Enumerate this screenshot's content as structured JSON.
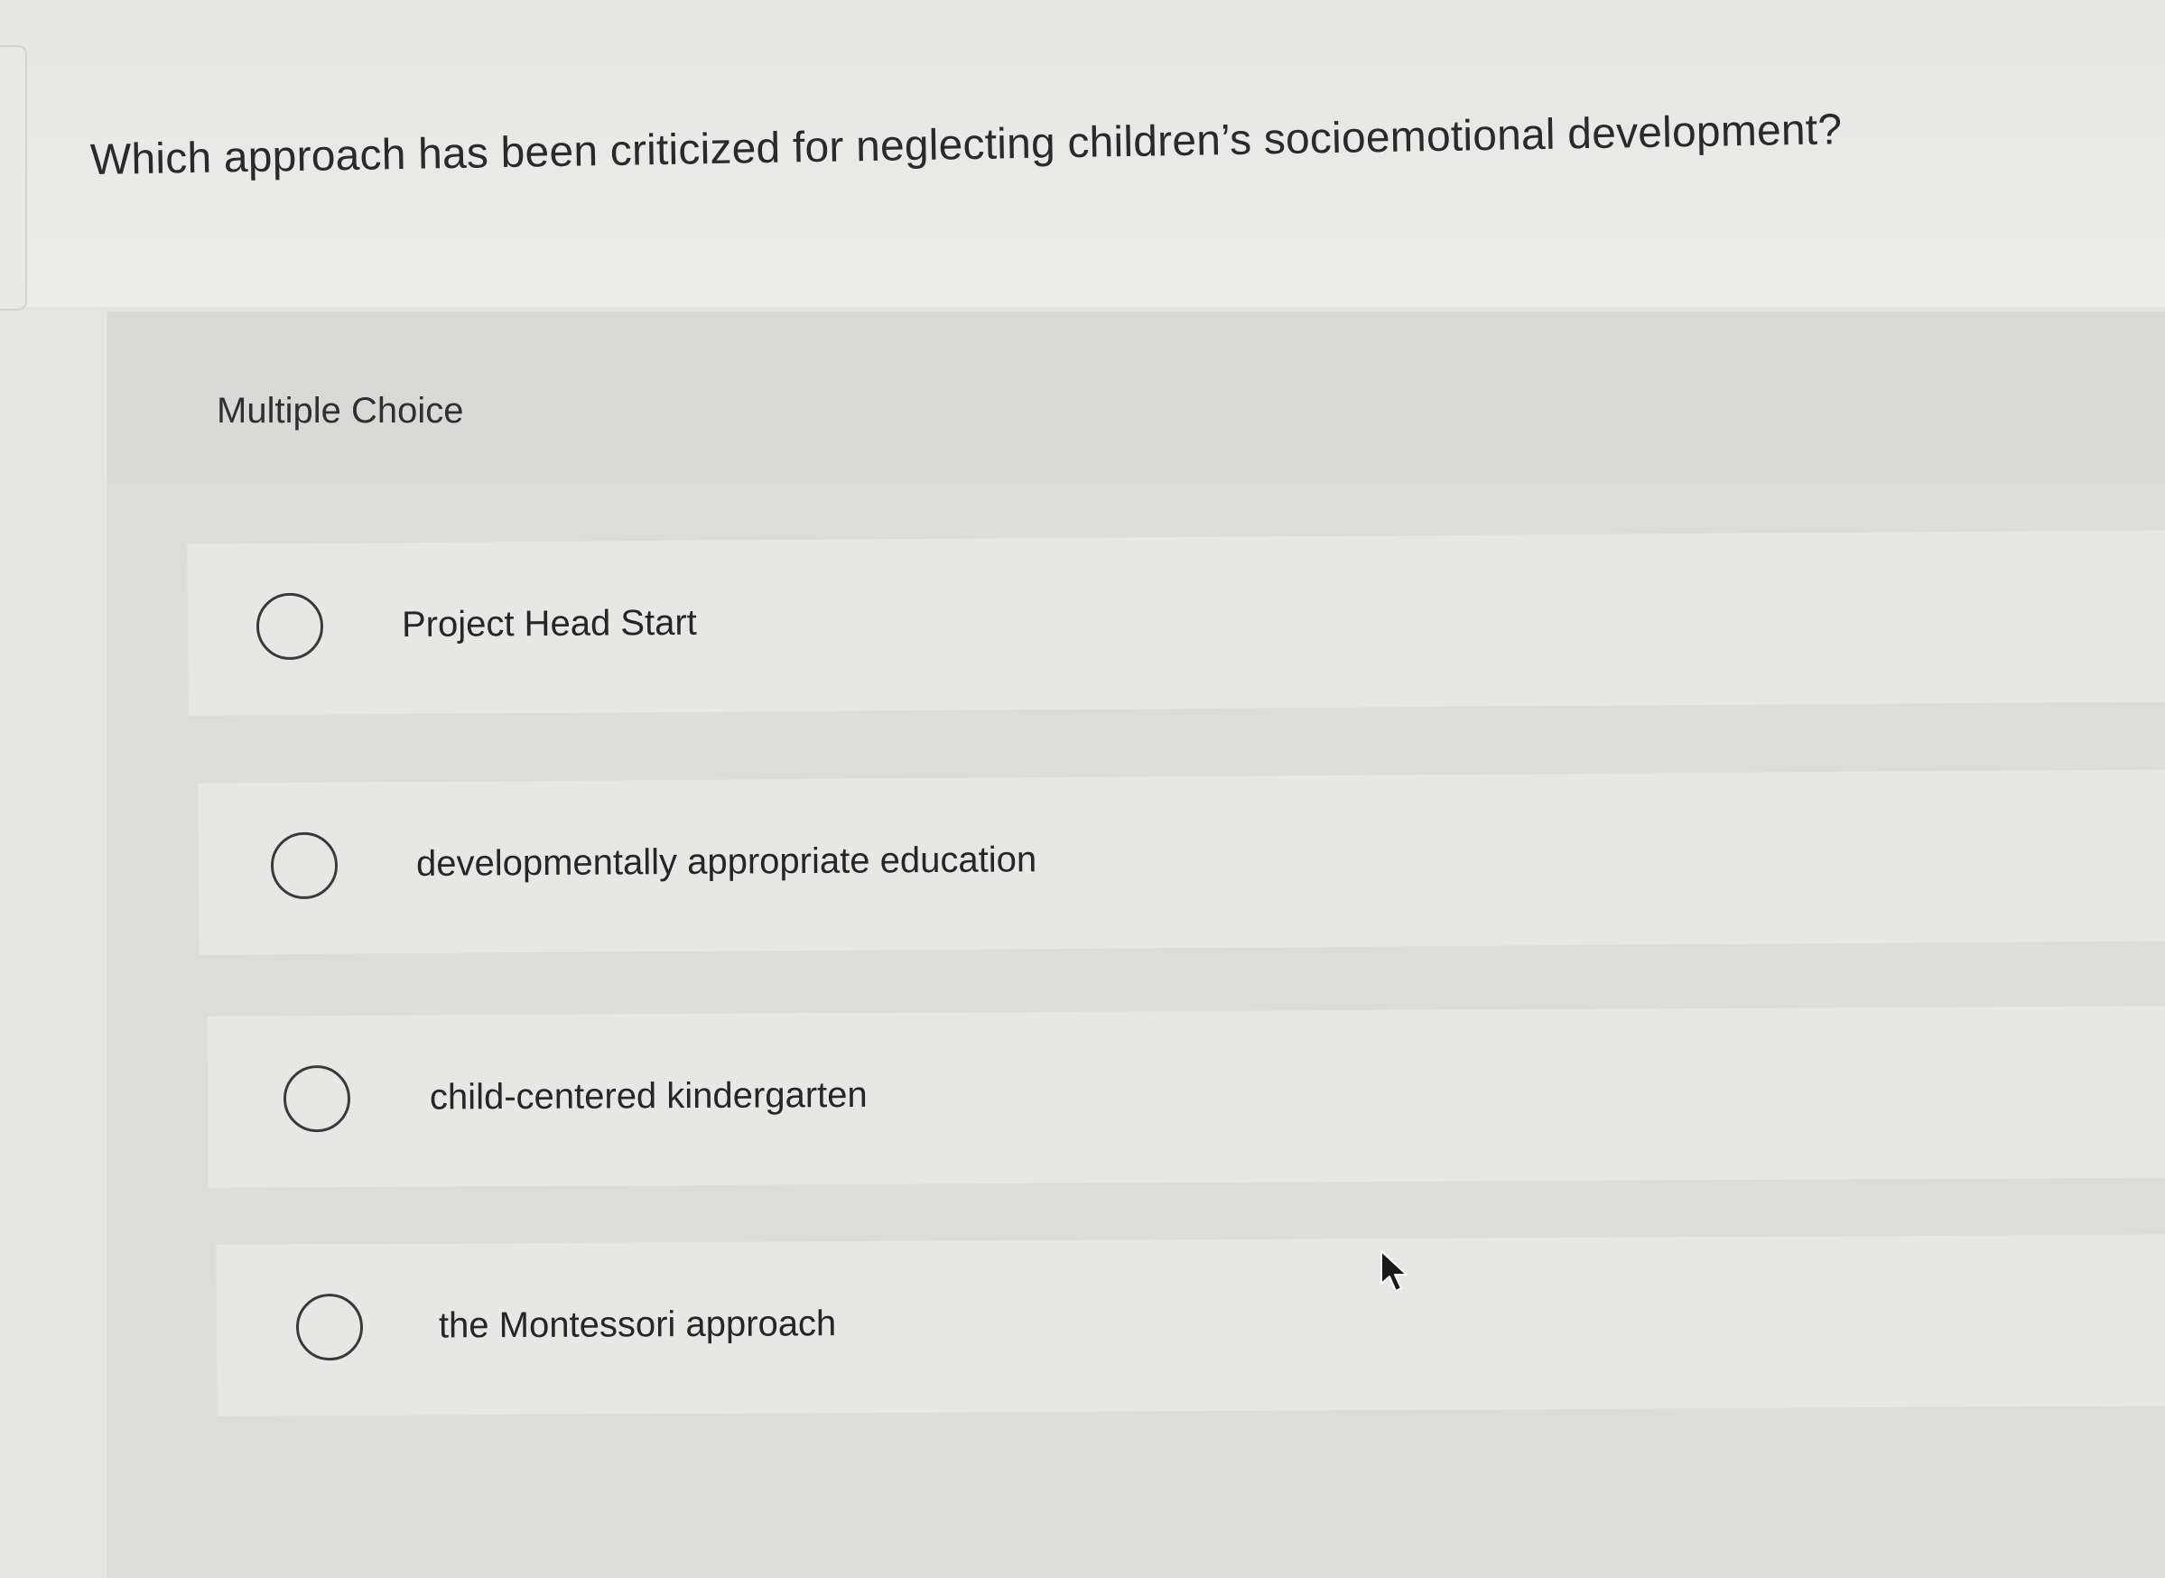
{
  "question": {
    "text": "Which approach has been criticized for neglecting children’s socioemotional development?"
  },
  "quiz": {
    "type_label": "Multiple Choice",
    "options": [
      {
        "label": "Project Head Start",
        "selected": false
      },
      {
        "label": "developmentally appropriate education",
        "selected": false
      },
      {
        "label": "child-centered kindergarten",
        "selected": false
      },
      {
        "label": "the Montessori approach",
        "selected": false
      }
    ]
  },
  "icons": {
    "radio": "radio-unchecked-icon",
    "cursor": "mouse-pointer-icon"
  }
}
